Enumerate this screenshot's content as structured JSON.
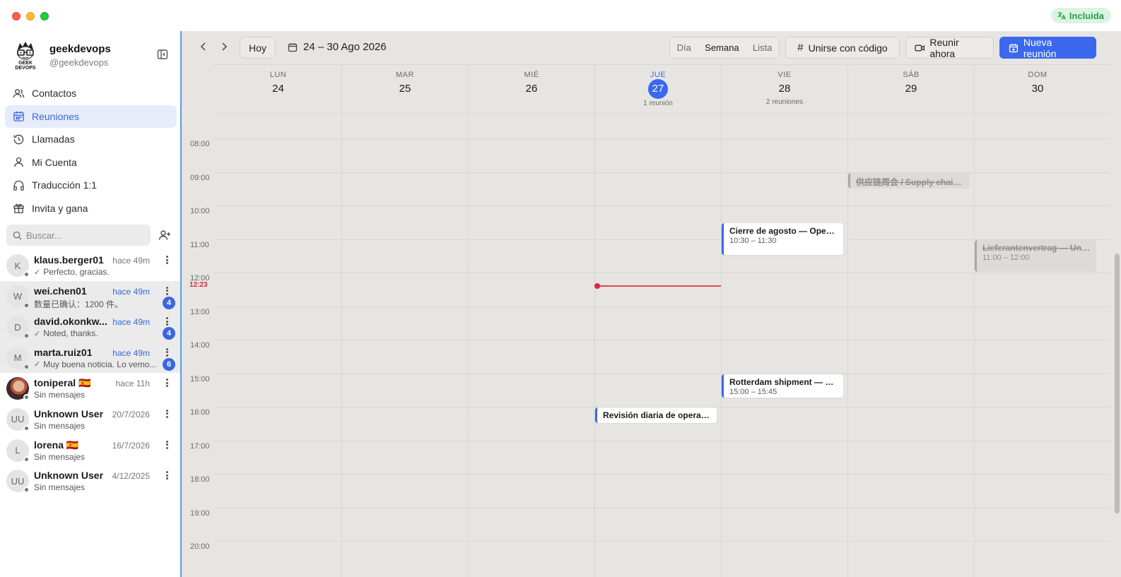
{
  "window": {
    "badge": "Incluida",
    "colors": {
      "accent": "#3b68ec",
      "now": "#e0263a",
      "badge_text": "#1fa14b",
      "badge_bg": "#dcf3e2"
    }
  },
  "profile": {
    "name": "geekdevops",
    "handle": "@geekdevops",
    "logo_text": "GEEK DEVOPS"
  },
  "nav": [
    {
      "label": "Contactos",
      "icon": "users-icon"
    },
    {
      "label": "Reuniones",
      "icon": "calendar-icon",
      "active": true
    },
    {
      "label": "Llamadas",
      "icon": "history-icon"
    },
    {
      "label": "Mi Cuenta",
      "icon": "user-icon"
    },
    {
      "label": "Traducción 1:1",
      "icon": "headphones-icon"
    },
    {
      "label": "Invita y gana",
      "icon": "gift-icon"
    }
  ],
  "search": {
    "placeholder": "Buscar..."
  },
  "chats": [
    {
      "initial": "K",
      "name": "klaus.berger01",
      "time": "hace 49m",
      "msg": "Perfecto, gracias.",
      "check": true,
      "unread": false,
      "badge": ""
    },
    {
      "initial": "W",
      "name": "wei.chen01",
      "time": "hace 49m",
      "msg": "数量已确认：1200 件。",
      "check": false,
      "unread": true,
      "badge": "4"
    },
    {
      "initial": "D",
      "name": "david.okonkw...",
      "time": "hace 49m",
      "msg": "Noted, thanks.",
      "check": true,
      "unread": true,
      "badge": "4"
    },
    {
      "initial": "M",
      "name": "marta.ruiz01",
      "time": "hace 49m",
      "msg": "Muy buena noticia. Lo vemo...",
      "check": true,
      "unread": true,
      "badge": "6"
    },
    {
      "initial": "",
      "name": "toniperal 🇪🇸",
      "time": "hace 11h",
      "msg": "Sin mensajes",
      "check": false,
      "unread": false,
      "badge": "",
      "photo": true
    },
    {
      "initial": "UU",
      "name": "Unknown User",
      "time": "20/7/2026",
      "msg": "Sin mensajes",
      "check": false,
      "unread": false,
      "badge": ""
    },
    {
      "initial": "L",
      "name": "lorena 🇪🇸",
      "time": "16/7/2026",
      "msg": "Sin mensajes",
      "check": false,
      "unread": false,
      "badge": ""
    },
    {
      "initial": "UU",
      "name": "Unknown User",
      "time": "4/12/2025",
      "msg": "Sin mensajes",
      "check": false,
      "unread": false,
      "badge": ""
    }
  ],
  "toolbar": {
    "today": "Hoy",
    "range": "24 – 30 Ago 2026",
    "views": [
      "Día",
      "Semana",
      "Lista"
    ],
    "selected_view": "Semana",
    "join_code": "Unirse con código",
    "meet_now": "Reunir ahora",
    "new_meeting": "Nueva reunión"
  },
  "days": [
    {
      "name": "LUN",
      "date": "24",
      "count": ""
    },
    {
      "name": "MAR",
      "date": "25",
      "count": ""
    },
    {
      "name": "MIÉ",
      "date": "26",
      "count": ""
    },
    {
      "name": "JUE",
      "date": "27",
      "count": "1 reunión",
      "today": true
    },
    {
      "name": "VIE",
      "date": "28",
      "count": "2 reuniones"
    },
    {
      "name": "SÁB",
      "date": "29",
      "count": ""
    },
    {
      "name": "DOM",
      "date": "30",
      "count": ""
    }
  ],
  "hours": [
    "08:00",
    "09:00",
    "10:00",
    "11:00",
    "12:00",
    "13:00",
    "14:00",
    "15:00",
    "16:00",
    "17:00",
    "18:00",
    "19:00",
    "20:00"
  ],
  "now": {
    "label": "12:23",
    "day_index": 3
  },
  "events": [
    {
      "day": 5,
      "start": "09:00",
      "end": "09:30",
      "title": "供应链周会 / Supply chain w...",
      "time": "",
      "cancelled": true
    },
    {
      "day": 4,
      "start": "10:30",
      "end": "11:30",
      "title": "Cierre de agosto — Operac...",
      "time": "10:30 – 11:30",
      "cancelled": false
    },
    {
      "day": 6,
      "start": "11:00",
      "end": "12:00",
      "title": "Lieferantenvertrag — Unte...",
      "time": "11:00 – 12:00",
      "cancelled": true
    },
    {
      "day": 4,
      "start": "15:00",
      "end": "15:45",
      "title": "Rotterdam shipment — sta...",
      "time": "15:00 – 15:45",
      "cancelled": false
    },
    {
      "day": 3,
      "start": "16:00",
      "end": "16:30",
      "title": "Revisión diaria de operaci...",
      "time": "",
      "cancelled": false
    }
  ]
}
